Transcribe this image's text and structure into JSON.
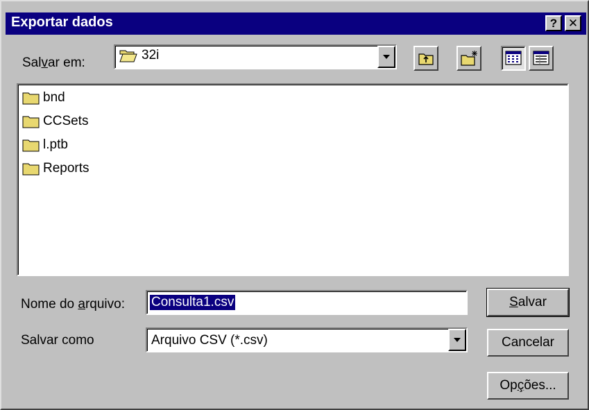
{
  "window": {
    "title": "Exportar dados",
    "help_label": "?",
    "close_label": "✕"
  },
  "save_in": {
    "label_pre": "Sal",
    "label_key": "v",
    "label_post": "ar em:",
    "value": "32i"
  },
  "toolbar": {
    "icons": [
      "up-folder-icon",
      "new-folder-icon",
      "list-view-icon",
      "details-view-icon"
    ]
  },
  "files": [
    {
      "name": "bnd"
    },
    {
      "name": "CCSets"
    },
    {
      "name": "l.ptb"
    },
    {
      "name": "Reports"
    }
  ],
  "filename": {
    "label_pre": "Nome do ",
    "label_key": "a",
    "label_post": "rquivo:",
    "value": "Consulta1.csv"
  },
  "save_as": {
    "label": "Salvar como",
    "value": "Arquivo CSV (*.csv)"
  },
  "buttons": {
    "save_key": "S",
    "save_rest": "alvar",
    "cancel": "Cancelar",
    "options_pre": "Op",
    "options_key": "ç",
    "options_post": "ões..."
  },
  "colors": {
    "titlebar": "#0a0080",
    "face": "#c0c0c0",
    "folder": "#e8d870"
  }
}
